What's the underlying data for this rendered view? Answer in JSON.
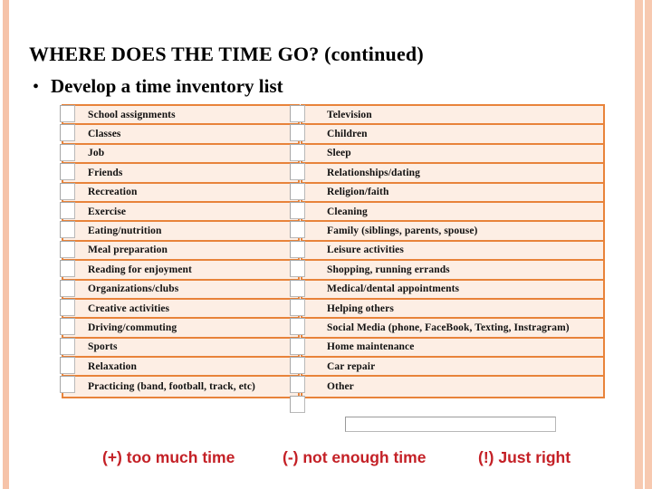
{
  "slide": {
    "title": "WHERE DOES THE TIME GO? (continued)",
    "bullet_marker": "•",
    "bullet_text": "Develop a time inventory list",
    "accent_border_color": "#e8833a",
    "row_fill_color": "#fdeee4",
    "edge_stripe_color": "#f6c3a9",
    "legend_color": "#c42026"
  },
  "inventory": {
    "left_column": [
      {
        "label": "School assignments",
        "checked": false
      },
      {
        "label": "Classes",
        "checked": false
      },
      {
        "label": "Job",
        "checked": false
      },
      {
        "label": "Friends",
        "checked": false
      },
      {
        "label": "Recreation",
        "checked": false
      },
      {
        "label": "Exercise",
        "checked": false
      },
      {
        "label": "Eating/nutrition",
        "checked": false
      },
      {
        "label": "Meal preparation",
        "checked": false
      },
      {
        "label": "Reading for enjoyment",
        "checked": false
      },
      {
        "label": "Organizations/clubs",
        "checked": false
      },
      {
        "label": "Creative activities",
        "checked": false
      },
      {
        "label": "Driving/commuting",
        "checked": false
      },
      {
        "label": "Sports",
        "checked": false
      },
      {
        "label": "Relaxation",
        "checked": false
      },
      {
        "label": "Practicing (band, football, track, etc)",
        "checked": false
      }
    ],
    "right_column": [
      {
        "label": "Television",
        "checked": false
      },
      {
        "label": "Children",
        "checked": false
      },
      {
        "label": "Sleep",
        "checked": false
      },
      {
        "label": "Relationships/dating",
        "checked": false
      },
      {
        "label": "Religion/faith",
        "checked": false
      },
      {
        "label": "Cleaning",
        "checked": false
      },
      {
        "label": "Family (siblings, parents, spouse)",
        "checked": false
      },
      {
        "label": "Leisure activities",
        "checked": false
      },
      {
        "label": "Shopping, running errands",
        "checked": false
      },
      {
        "label": "Medical/dental appointments",
        "checked": false
      },
      {
        "label": "Helping others",
        "checked": false
      },
      {
        "label": "Social Media (phone, FaceBook, Texting, Instragram)",
        "checked": false
      },
      {
        "label": "Home maintenance",
        "checked": false
      },
      {
        "label": "Car repair",
        "checked": false
      },
      {
        "label": "Other",
        "checked": false
      }
    ],
    "extra_checkbox_count": 1
  },
  "answer_field": {
    "value": "",
    "placeholder": ""
  },
  "legend": {
    "items": [
      {
        "symbol": "(+)",
        "text": "too much time",
        "full": "(+) too much time"
      },
      {
        "symbol": "(-)",
        "text": "not enough time",
        "full": "(-) not enough time"
      },
      {
        "symbol": "(!)",
        "text": "Just right",
        "full": "(!)  Just right"
      }
    ]
  }
}
